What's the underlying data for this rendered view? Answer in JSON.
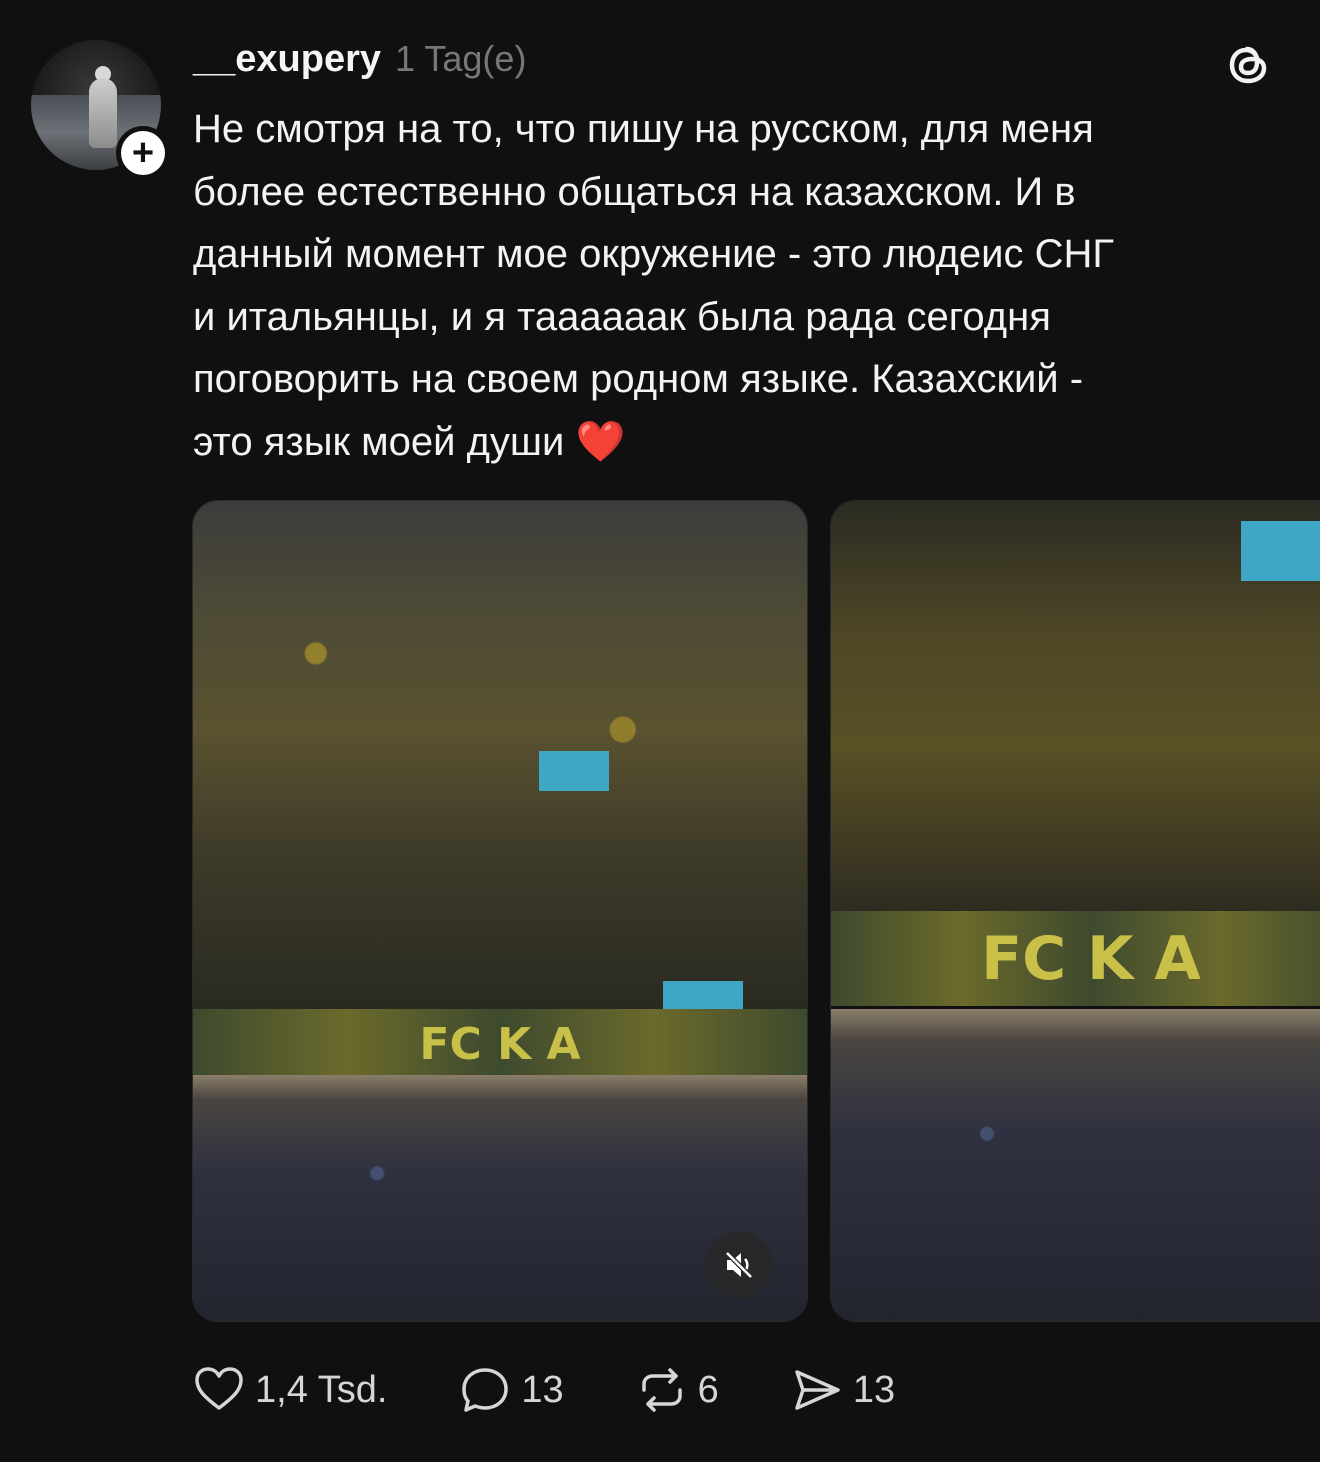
{
  "post": {
    "username": "__exupery",
    "timestamp": "1 Tag(e)",
    "text": "Не смотря на то, что пишу на русском, для меня\nболее естественно общаться на казахском. И в\nданный момент мое окружение - это людеис СНГ\nи итальянцы, и я тааааaак была рада сегодня\nпоговорить на своем родном  языке. Казахский -\nэто язык  моей души ❤️",
    "media": [
      {
        "type": "video",
        "banner_text": "FC K A"
      },
      {
        "type": "image",
        "banner_text": "FC K A"
      }
    ]
  },
  "actions": {
    "likes": "1,4 Tsd.",
    "comments": "13",
    "reposts": "6",
    "shares": "13"
  },
  "icons": {
    "follow": "plus-icon",
    "logo": "threads-logo-icon",
    "mute": "muted-speaker-icon",
    "like": "heart-icon",
    "comment": "speech-bubble-icon",
    "repost": "repost-arrows-icon",
    "share": "paper-plane-icon"
  },
  "colors": {
    "background": "#101010",
    "text": "#f3f3f3",
    "muted": "#777777",
    "heart_emoji": "#e0312b"
  }
}
